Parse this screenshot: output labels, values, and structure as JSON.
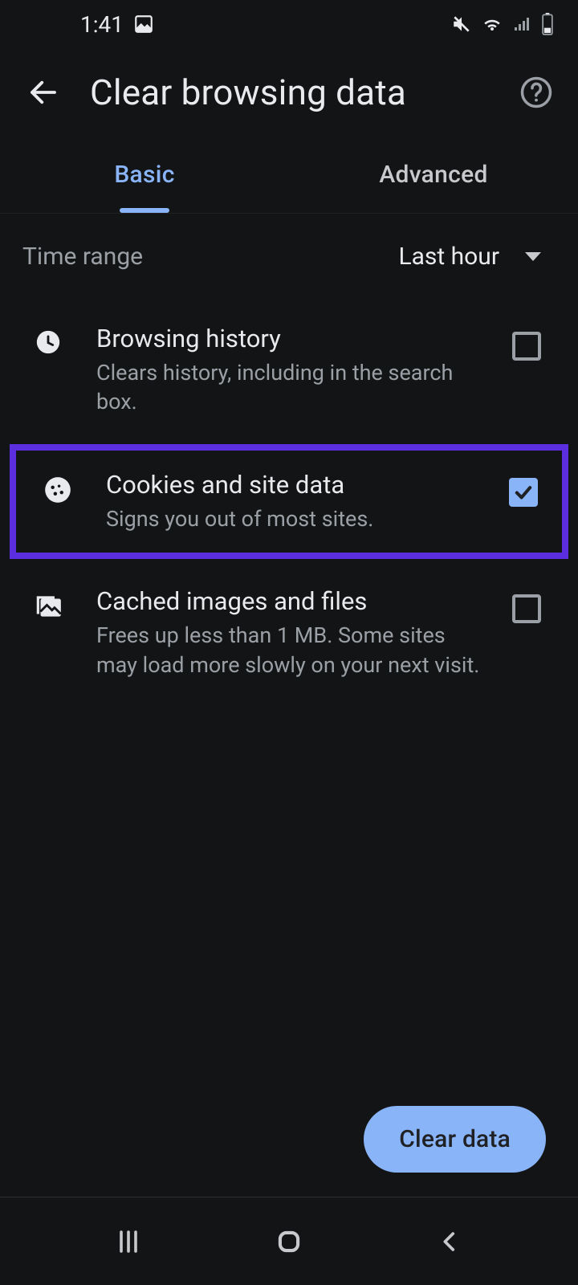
{
  "status": {
    "time": "1:41"
  },
  "header": {
    "title": "Clear browsing data"
  },
  "tabs": {
    "basic": "Basic",
    "advanced": "Advanced",
    "active": "basic"
  },
  "time_range": {
    "label": "Time range",
    "value": "Last hour"
  },
  "items": [
    {
      "title": "Browsing history",
      "subtitle": "Clears history, including in the search box.",
      "checked": false
    },
    {
      "title": "Cookies and site data",
      "subtitle": "Signs you out of most sites.",
      "checked": true
    },
    {
      "title": "Cached images and files",
      "subtitle": "Frees up less than 1 MB. Some sites may load more slowly on your next visit.",
      "checked": false
    }
  ],
  "action": {
    "clear_label": "Clear data"
  }
}
